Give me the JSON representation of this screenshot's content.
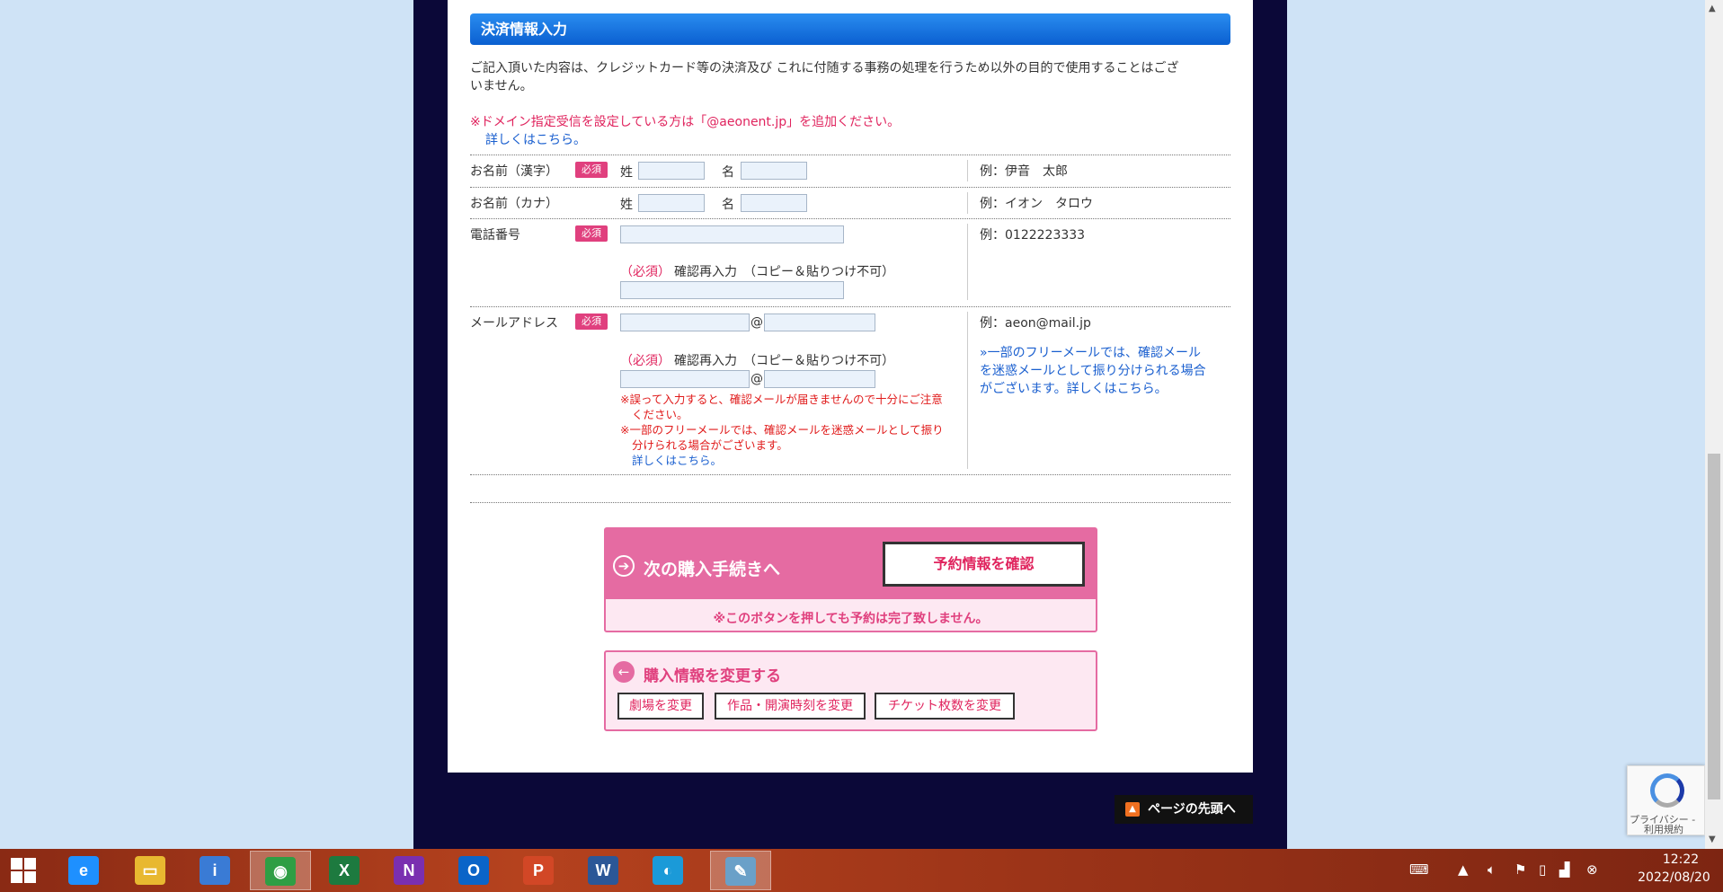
{
  "section": {
    "title": "決済情報入力",
    "intro_line1": "ご記入頂いた内容は、クレジットカード等の決済及び これに付随する事務の処理を行うため以外の目的で使用することはござ",
    "intro_line2": "いません。",
    "domain_note": "※ドメイン指定受信を設定している方は「@aeonent.jp」を追加ください。",
    "details_link": "詳しくはこちら。"
  },
  "form": {
    "required_badge": "必須",
    "name_kanji": {
      "label": "お名前（漢字）",
      "last_label": "姓",
      "first_label": "名",
      "example": "例：伊音　太郎"
    },
    "name_kana": {
      "label": "お名前（カナ）",
      "last_label": "姓",
      "first_label": "名",
      "example": "例：イオン　タロウ"
    },
    "phone": {
      "label": "電話番号",
      "example": "例：0122223333",
      "confirm_required": "（必須）",
      "confirm_text": "確認再入力　（コピー＆貼りつけ不可）"
    },
    "email": {
      "label": "メールアドレス",
      "at": "@",
      "example": "例：aeon@mail.jp",
      "confirm_required": "（必須）",
      "confirm_text": "確認再入力　（コピー＆貼りつけ不可）",
      "warn1_line1": "※誤って入力すると、確認メールが届きませんので十分にご注意",
      "warn1_line2": "ください。",
      "warn2_line1": "※一部のフリーメールでは、確認メールを迷惑メールとして振り",
      "warn2_line2": "分けられる場合がございます。",
      "warn_link": "詳しくはこちら。",
      "side_note_line1": "»一部のフリーメールでは、確認メール",
      "side_note_line2": "を迷惑メールとして振り分けられる場合",
      "side_note_line3": "がございます。詳しくはこちら。"
    }
  },
  "next_step": {
    "label": "次の購入手続きへ",
    "confirm_button": "予約情報を確認",
    "note": "※このボタンを押しても予約は完了致しません。"
  },
  "change": {
    "label": "購入情報を変更する",
    "buttons": [
      "劇場を変更",
      "作品・開演時刻を変更",
      "チケット枚数を変更"
    ]
  },
  "page_top": "ページの先頭へ",
  "recaptcha": {
    "line1": "プライバシー -",
    "line2": "利用規約"
  },
  "taskbar": {
    "apps": [
      {
        "name": "internet-explorer",
        "glyph": "e",
        "color": "#1e90ff"
      },
      {
        "name": "file-explorer",
        "glyph": "▭",
        "color": "#e8b830"
      },
      {
        "name": "info",
        "glyph": "i",
        "color": "#3a7bd5"
      },
      {
        "name": "chrome",
        "glyph": "◉",
        "color": "#2f9e44"
      },
      {
        "name": "excel",
        "glyph": "X",
        "color": "#1d7a3f"
      },
      {
        "name": "onenote",
        "glyph": "N",
        "color": "#7a2fb0"
      },
      {
        "name": "outlook",
        "glyph": "O",
        "color": "#0a64c8"
      },
      {
        "name": "powerpoint",
        "glyph": "P",
        "color": "#d24726"
      },
      {
        "name": "word",
        "glyph": "W",
        "color": "#2b5797"
      },
      {
        "name": "edge",
        "glyph": "◐",
        "color": "#1b9ad8"
      },
      {
        "name": "paint",
        "glyph": "✎",
        "color": "#6aa0c8"
      }
    ],
    "time": "12:22",
    "date": "2022/08/20"
  }
}
